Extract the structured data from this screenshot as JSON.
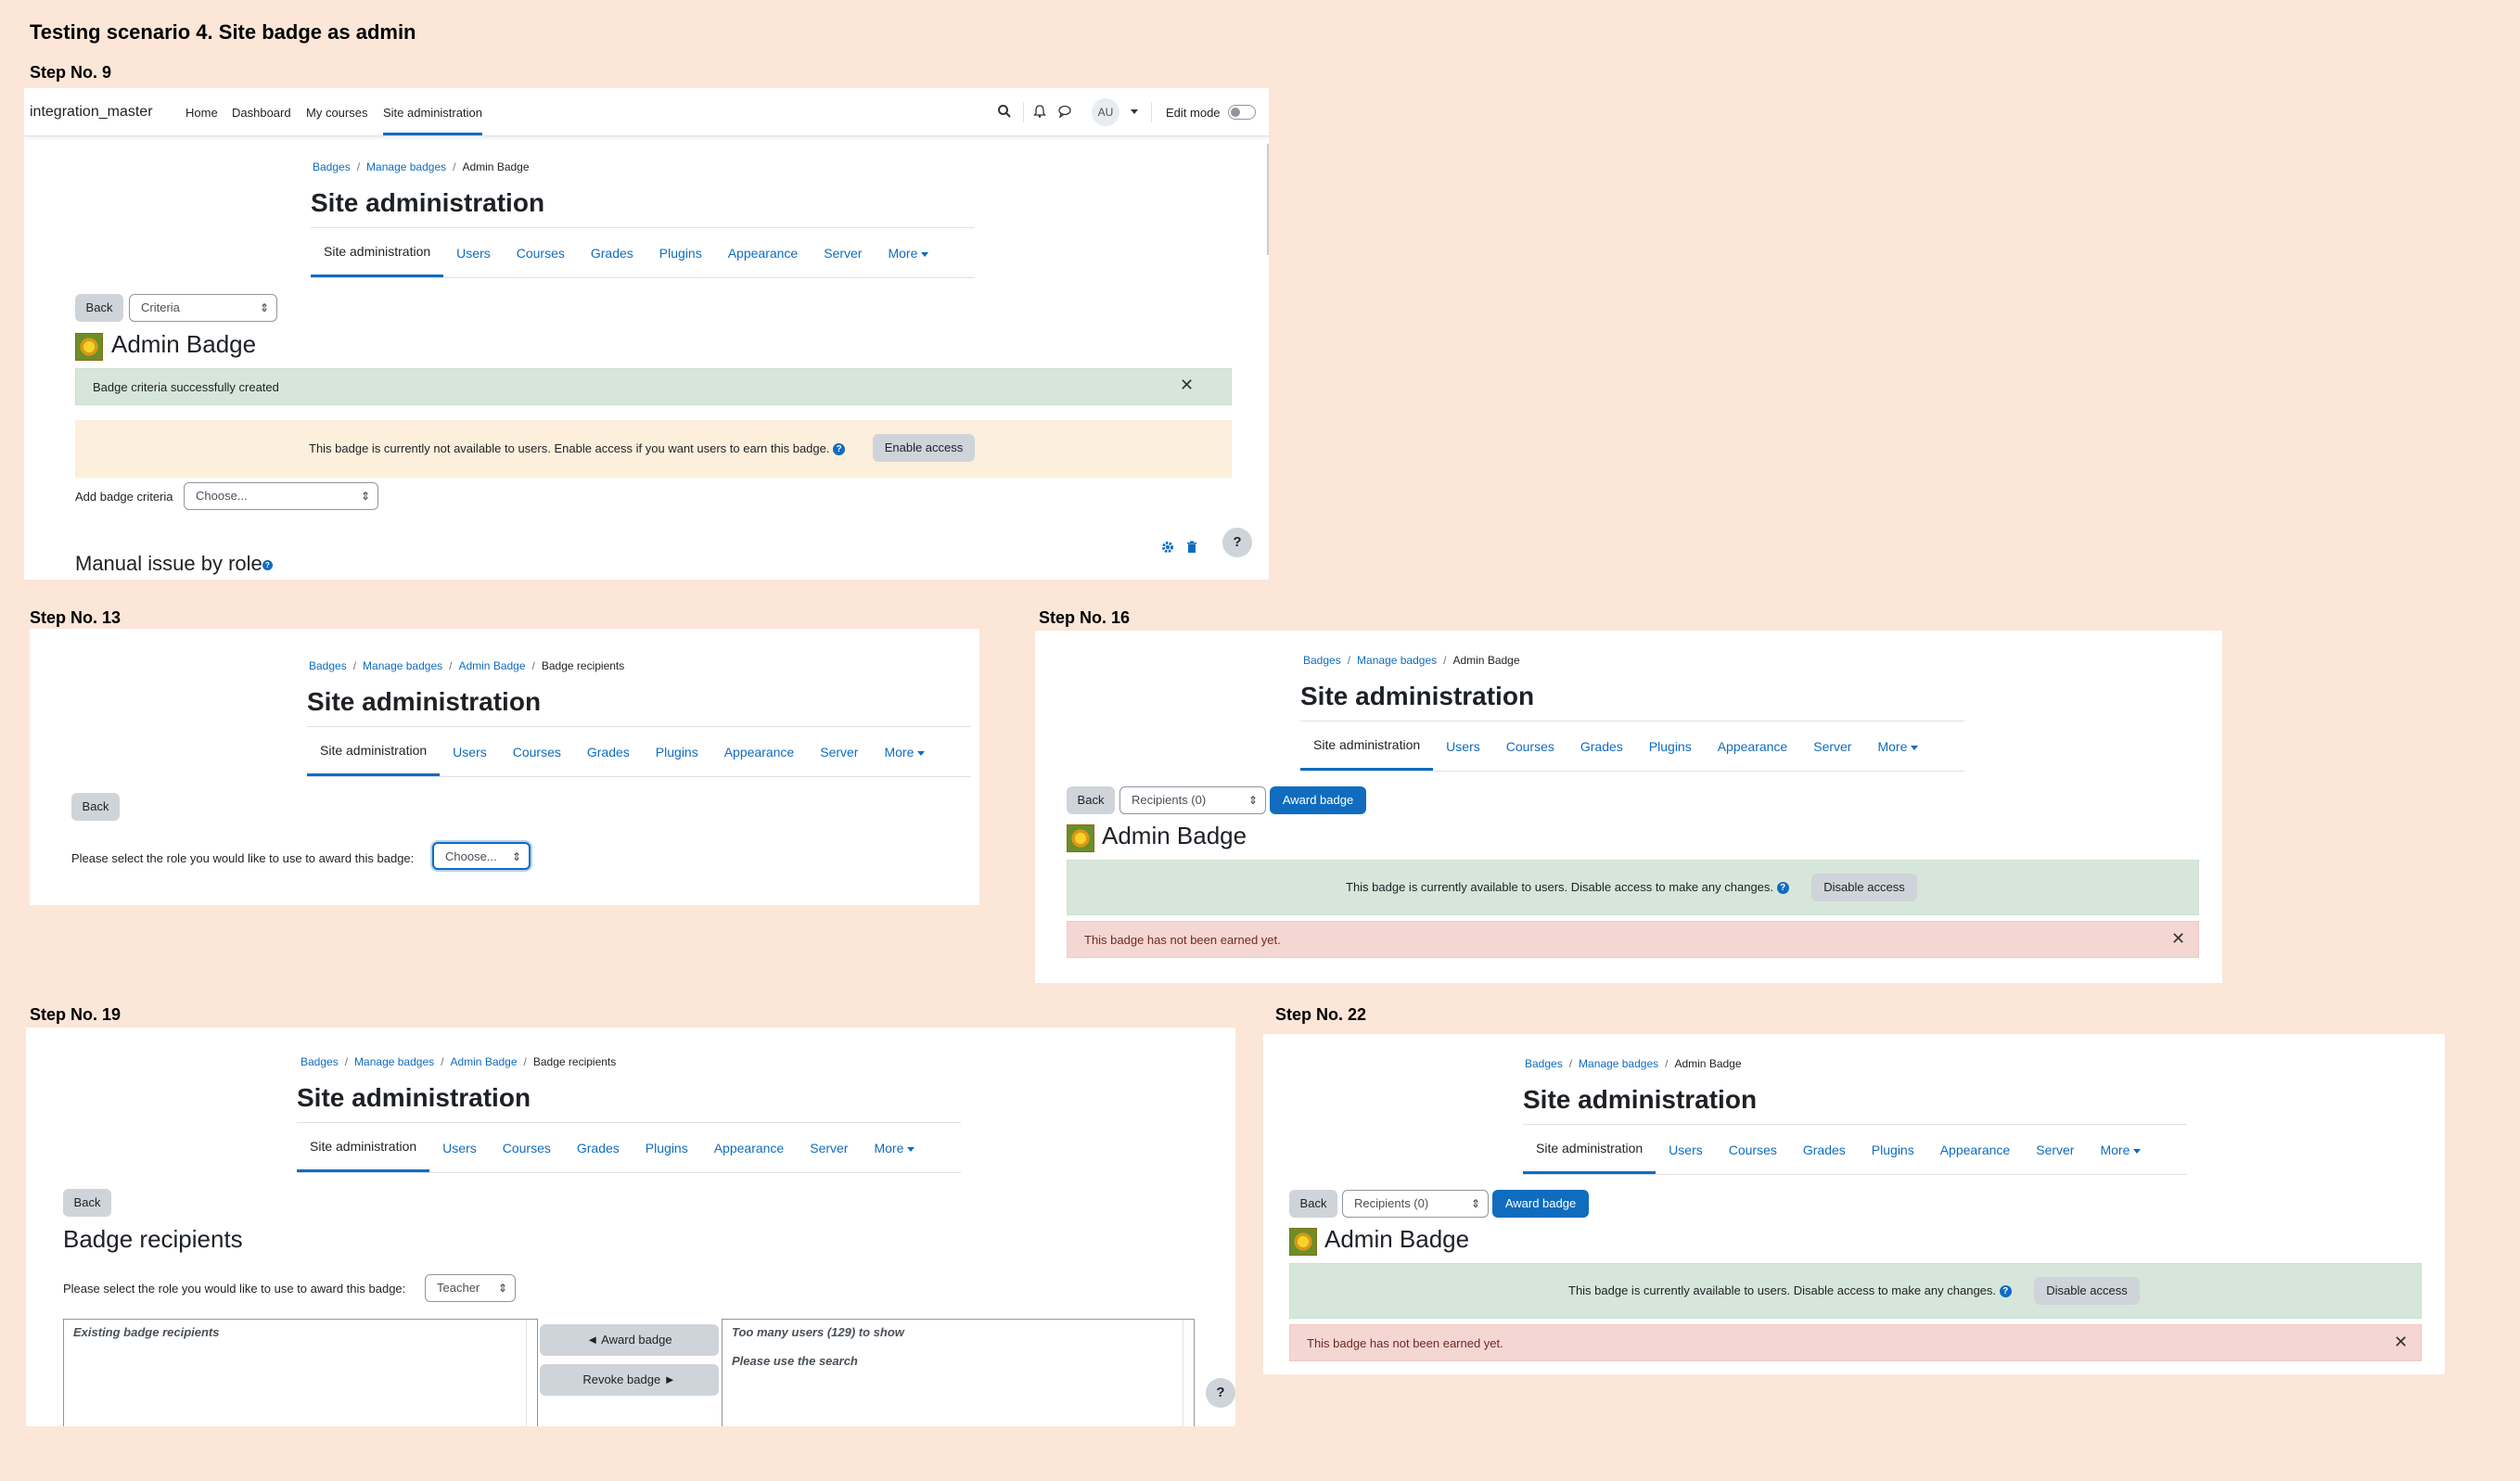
{
  "doc_title": "Testing scenario 4. Site badge as admin",
  "common": {
    "crumb_badges": "Badges",
    "crumb_manage": "Manage badges",
    "crumb_admin_badge": "Admin Badge",
    "crumb_recipients": "Badge recipients",
    "page_heading": "Site administration",
    "tabs": [
      "Site administration",
      "Users",
      "Courses",
      "Grades",
      "Plugins",
      "Appearance",
      "Server",
      "More"
    ],
    "back": "Back",
    "badge_name": "Admin Badge",
    "award_badge": "Award badge",
    "recipients_select": "Recipients (0)",
    "available_text": "This badge is currently available to users. Disable access to make any changes.",
    "disable_access": "Disable access",
    "not_earned": "This badge has not been earned yet.",
    "select_role_prompt": "Please select the role you would like to use to award this badge:",
    "help": "?"
  },
  "step9": {
    "label": "Step No. 9",
    "site_name": "integration_master",
    "nav": [
      "Home",
      "Dashboard",
      "My courses",
      "Site administration"
    ],
    "avatar": "AU",
    "edit_mode": "Edit mode",
    "criteria_select": "Criteria",
    "success_msg": "Badge criteria successfully created",
    "unavailable_msg": "This badge is currently not available to users. Enable access if you want users to earn this badge.",
    "enable_access": "Enable access",
    "add_criteria_label": "Add badge criteria",
    "add_criteria_select": "Choose...",
    "manual_issue": "Manual issue by role"
  },
  "step13": {
    "label": "Step No. 13",
    "role_select": "Choose..."
  },
  "step16": {
    "label": "Step No. 16"
  },
  "step19": {
    "label": "Step No. 19",
    "heading": "Badge recipients",
    "role_select": "Teacher",
    "existing_header": "Existing badge recipients",
    "award_btn": "◄ Award badge",
    "revoke_btn": "Revoke badge ►",
    "too_many": "Too many users (129) to show",
    "use_search": "Please use the search"
  },
  "step22": {
    "label": "Step No. 22"
  }
}
